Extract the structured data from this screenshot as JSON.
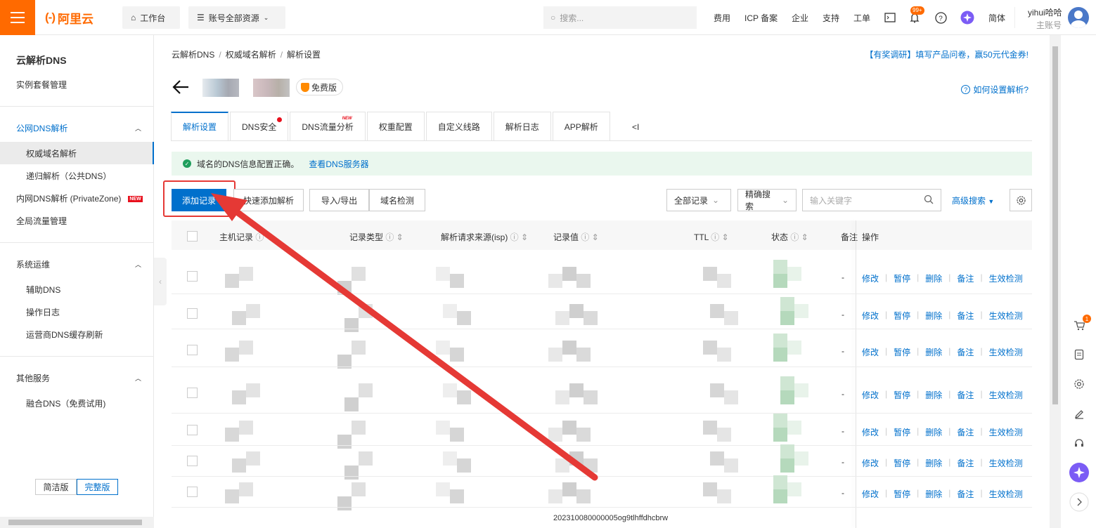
{
  "topbar": {
    "brand": "阿里云",
    "workbench": "工作台",
    "resource_scope": "账号全部资源",
    "search_placeholder": "搜索...",
    "links": [
      "费用",
      "ICP 备案",
      "企业",
      "支持",
      "工单"
    ],
    "notification_badge": "99+",
    "language": "简体",
    "user_name": "yihui哈哈",
    "user_role": "主账号"
  },
  "sidebar": {
    "title": "云解析DNS",
    "instance_mgmt": "实例套餐管理",
    "public_dns": "公网DNS解析",
    "authoritative": "权威域名解析",
    "recursive": "递归解析（公共DNS）",
    "private_zone": "内网DNS解析 (PrivateZone)",
    "new_tag": "NEW",
    "global_traffic": "全局流量管理",
    "ops": "系统运维",
    "aux_dns": "辅助DNS",
    "op_log": "操作日志",
    "isp_cache": "运营商DNS缓存刷新",
    "other": "其他服务",
    "fusion_dns": "融合DNS（免费试用)",
    "simple_ver": "简洁版",
    "full_ver": "完整版"
  },
  "main": {
    "breadcrumb": [
      "云解析DNS",
      "权威域名解析",
      "解析设置"
    ],
    "survey": "【有奖调研】填写产品问卷，赢50元代金券!",
    "free_tag": "免费版",
    "howto": "如何设置解析?",
    "tabs": [
      "解析设置",
      "DNS安全",
      "DNS流量分析",
      "权重配置",
      "自定义线路",
      "解析日志",
      "APP解析"
    ],
    "tabs_more": "<I",
    "new_mark": "NEW",
    "alert_text": "域名的DNS信息配置正确。",
    "alert_link": "查看DNS服务器",
    "add_record": "添加记录",
    "quick_add": "快速添加解析",
    "import_export": "导入/导出",
    "domain_check": "域名检测",
    "all_records": "全部记录",
    "exact_search": "精确搜索",
    "keyword_placeholder": "输入关键字",
    "advanced_search": "高级搜索",
    "columns": [
      "主机记录",
      "记录类型",
      "解析请求来源(isp)",
      "记录值",
      "TTL",
      "状态",
      "备注",
      "操作"
    ],
    "row_dash": "-",
    "ops": [
      "修改",
      "暂停",
      "删除",
      "备注",
      "生效检测"
    ],
    "bottom_id": "202310080000005og9tlhffdhcbrw"
  },
  "colors": {
    "brand_orange": "#ff6a00",
    "primary_blue": "#0070cc",
    "annotation_red": "#e53935",
    "success_green": "#1f9e5c"
  },
  "floating_bar": {
    "cart_badge": "1"
  }
}
